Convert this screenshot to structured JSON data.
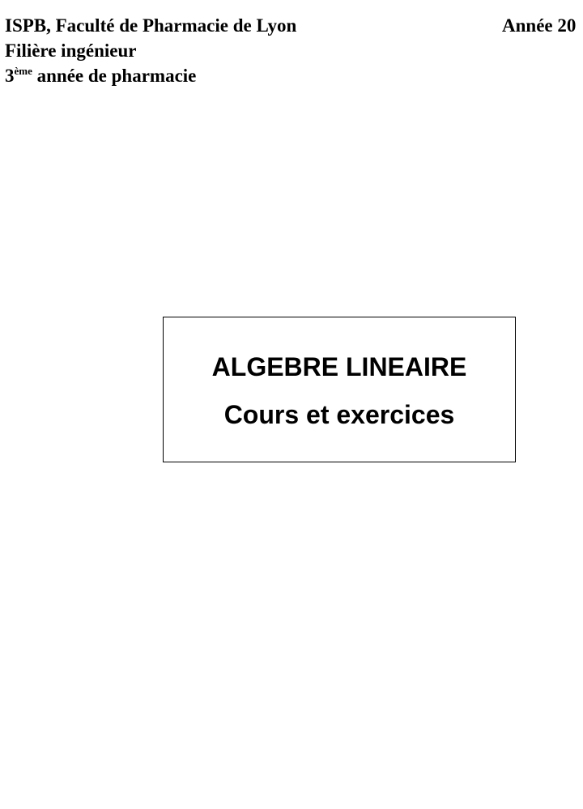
{
  "header": {
    "institution": "ISPB, Faculté de Pharmacie de Lyon",
    "year": "Année 20",
    "track": "Filière ingénieur",
    "level_number": "3",
    "level_superscript": "ème",
    "level_rest": " année de pharmacie"
  },
  "title_box": {
    "title": "ALGEBRE LINEAIRE",
    "subtitle": "Cours et exercices"
  }
}
